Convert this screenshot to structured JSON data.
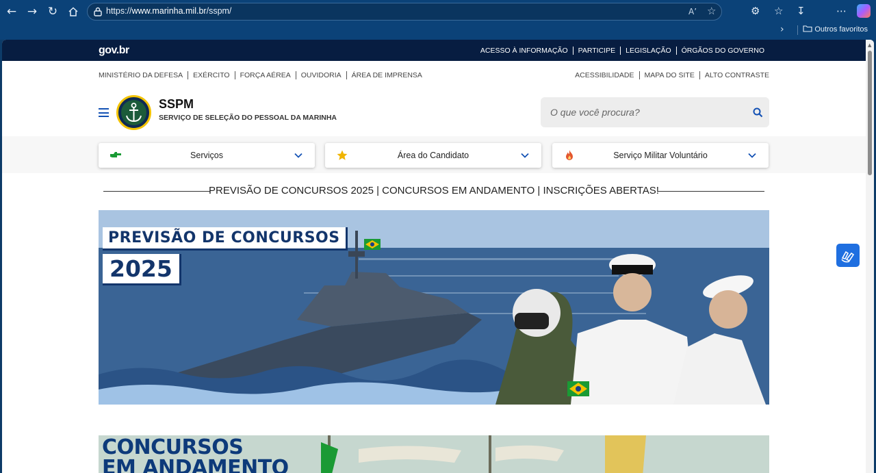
{
  "browser": {
    "url_prefix": "https://",
    "url_host": "www.marinha.mil.br",
    "url_path": "/sspm/",
    "favorites_label": "Outros favoritos"
  },
  "govbar": {
    "logo": "gov.br",
    "links": [
      "ACESSO À INFORMAÇÃO",
      "PARTICIPE",
      "LEGISLAÇÃO",
      "ÓRGÃOS DO GOVERNO"
    ]
  },
  "toplinks_left": [
    "MINISTÉRIO DA DEFESA",
    "EXÉRCITO",
    "FORÇA AÉREA",
    "OUVIDORIA",
    "ÁREA DE IMPRENSA"
  ],
  "toplinks_right": [
    "ACESSIBILIDADE",
    "MAPA DO SITE",
    "ALTO CONTRASTE"
  ],
  "header": {
    "title": "SSPM",
    "subtitle": "SERVIÇO DE SELEÇÃO DO PESSOAL DA MARINHA",
    "search_placeholder": "O que você procura?"
  },
  "menu": [
    {
      "label": "Serviços",
      "icon": "pointing-hand-icon",
      "color": "#1a9a34"
    },
    {
      "label": "Área do Candidato",
      "icon": "star-icon",
      "color": "#f0b400"
    },
    {
      "label": "Serviço Militar Voluntário",
      "icon": "flame-icon",
      "color": "#e4572e"
    }
  ],
  "headline": "PREVISÃO DE CONCURSOS 2025 | CONCURSOS EM ANDAMENTO | INSCRIÇÕES ABERTAS!",
  "banner": {
    "line1": "PREVISÃO DE CONCURSOS",
    "line2": "2025"
  },
  "banner2": {
    "line1": "CONCURSOS",
    "line2": "EM ANDAMENTO"
  },
  "colors": {
    "gov_blue": "#071d41",
    "link_blue": "#1351b4",
    "browser_frame": "#0b4278"
  }
}
